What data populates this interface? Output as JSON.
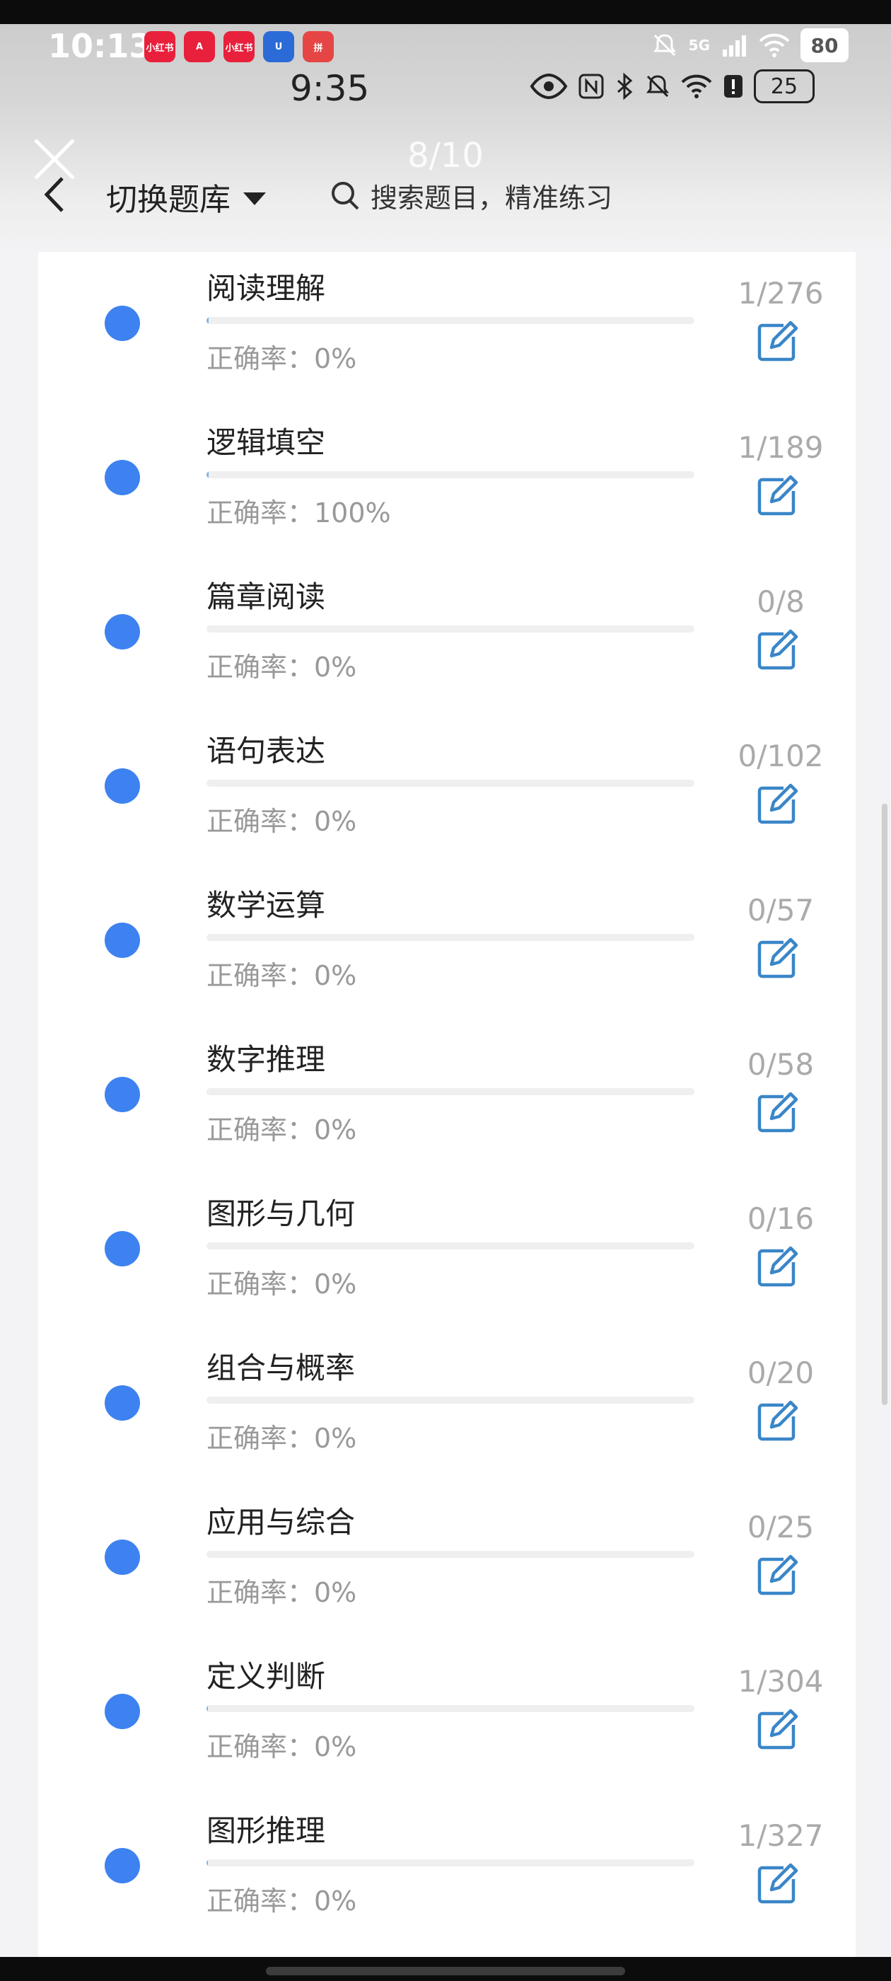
{
  "outer_status": {
    "time": "10:13",
    "network": "5G",
    "battery": "80",
    "apps": [
      {
        "label": "小红书",
        "color": "#e8203b"
      },
      {
        "label": "A",
        "color": "#e8203b"
      },
      {
        "label": "小红书",
        "color": "#e8203b"
      },
      {
        "label": "U",
        "color": "#2b6bd8"
      },
      {
        "label": "拼",
        "color": "#e64545"
      }
    ]
  },
  "inner_status": {
    "time": "9:35",
    "battery": "25"
  },
  "header": {
    "counter": "8/10",
    "switch_label": "切换题库",
    "search_placeholder": "搜索题目，精准练习"
  },
  "colors": {
    "accent": "#3d82f0",
    "progress": "#7fb2e6",
    "edit_icon": "#3a86c8"
  },
  "items": [
    {
      "name": "阅读理解",
      "accuracy": "正确率：0%",
      "count": "1/276",
      "progress": 0.004
    },
    {
      "name": "逻辑填空",
      "accuracy": "正确率：100%",
      "count": "1/189",
      "progress": 0.005
    },
    {
      "name": "篇章阅读",
      "accuracy": "正确率：0%",
      "count": "0/8",
      "progress": 0
    },
    {
      "name": "语句表达",
      "accuracy": "正确率：0%",
      "count": "0/102",
      "progress": 0
    },
    {
      "name": "数学运算",
      "accuracy": "正确率：0%",
      "count": "0/57",
      "progress": 0
    },
    {
      "name": "数字推理",
      "accuracy": "正确率：0%",
      "count": "0/58",
      "progress": 0
    },
    {
      "name": "图形与几何",
      "accuracy": "正确率：0%",
      "count": "0/16",
      "progress": 0
    },
    {
      "name": "组合与概率",
      "accuracy": "正确率：0%",
      "count": "0/20",
      "progress": 0
    },
    {
      "name": "应用与综合",
      "accuracy": "正确率：0%",
      "count": "0/25",
      "progress": 0
    },
    {
      "name": "定义判断",
      "accuracy": "正确率：0%",
      "count": "1/304",
      "progress": 0.003
    },
    {
      "name": "图形推理",
      "accuracy": "正确率：0%",
      "count": "1/327",
      "progress": 0.003
    }
  ]
}
